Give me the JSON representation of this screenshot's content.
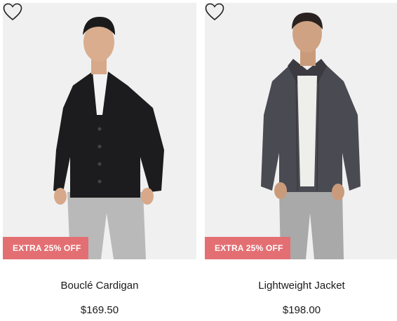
{
  "products": [
    {
      "name": "Bouclé Cardigan",
      "price": "$169.50",
      "badge": "EXTRA 25% OFF",
      "favorite_icon": "heart-outline-icon"
    },
    {
      "name": "Lightweight Jacket",
      "price": "$198.00",
      "badge": "EXTRA 25% OFF",
      "favorite_icon": "heart-outline-icon"
    }
  ],
  "colors": {
    "badge_bg": "#e46f73",
    "image_bg": "#f0f0f0",
    "text": "#1a1a1a"
  }
}
